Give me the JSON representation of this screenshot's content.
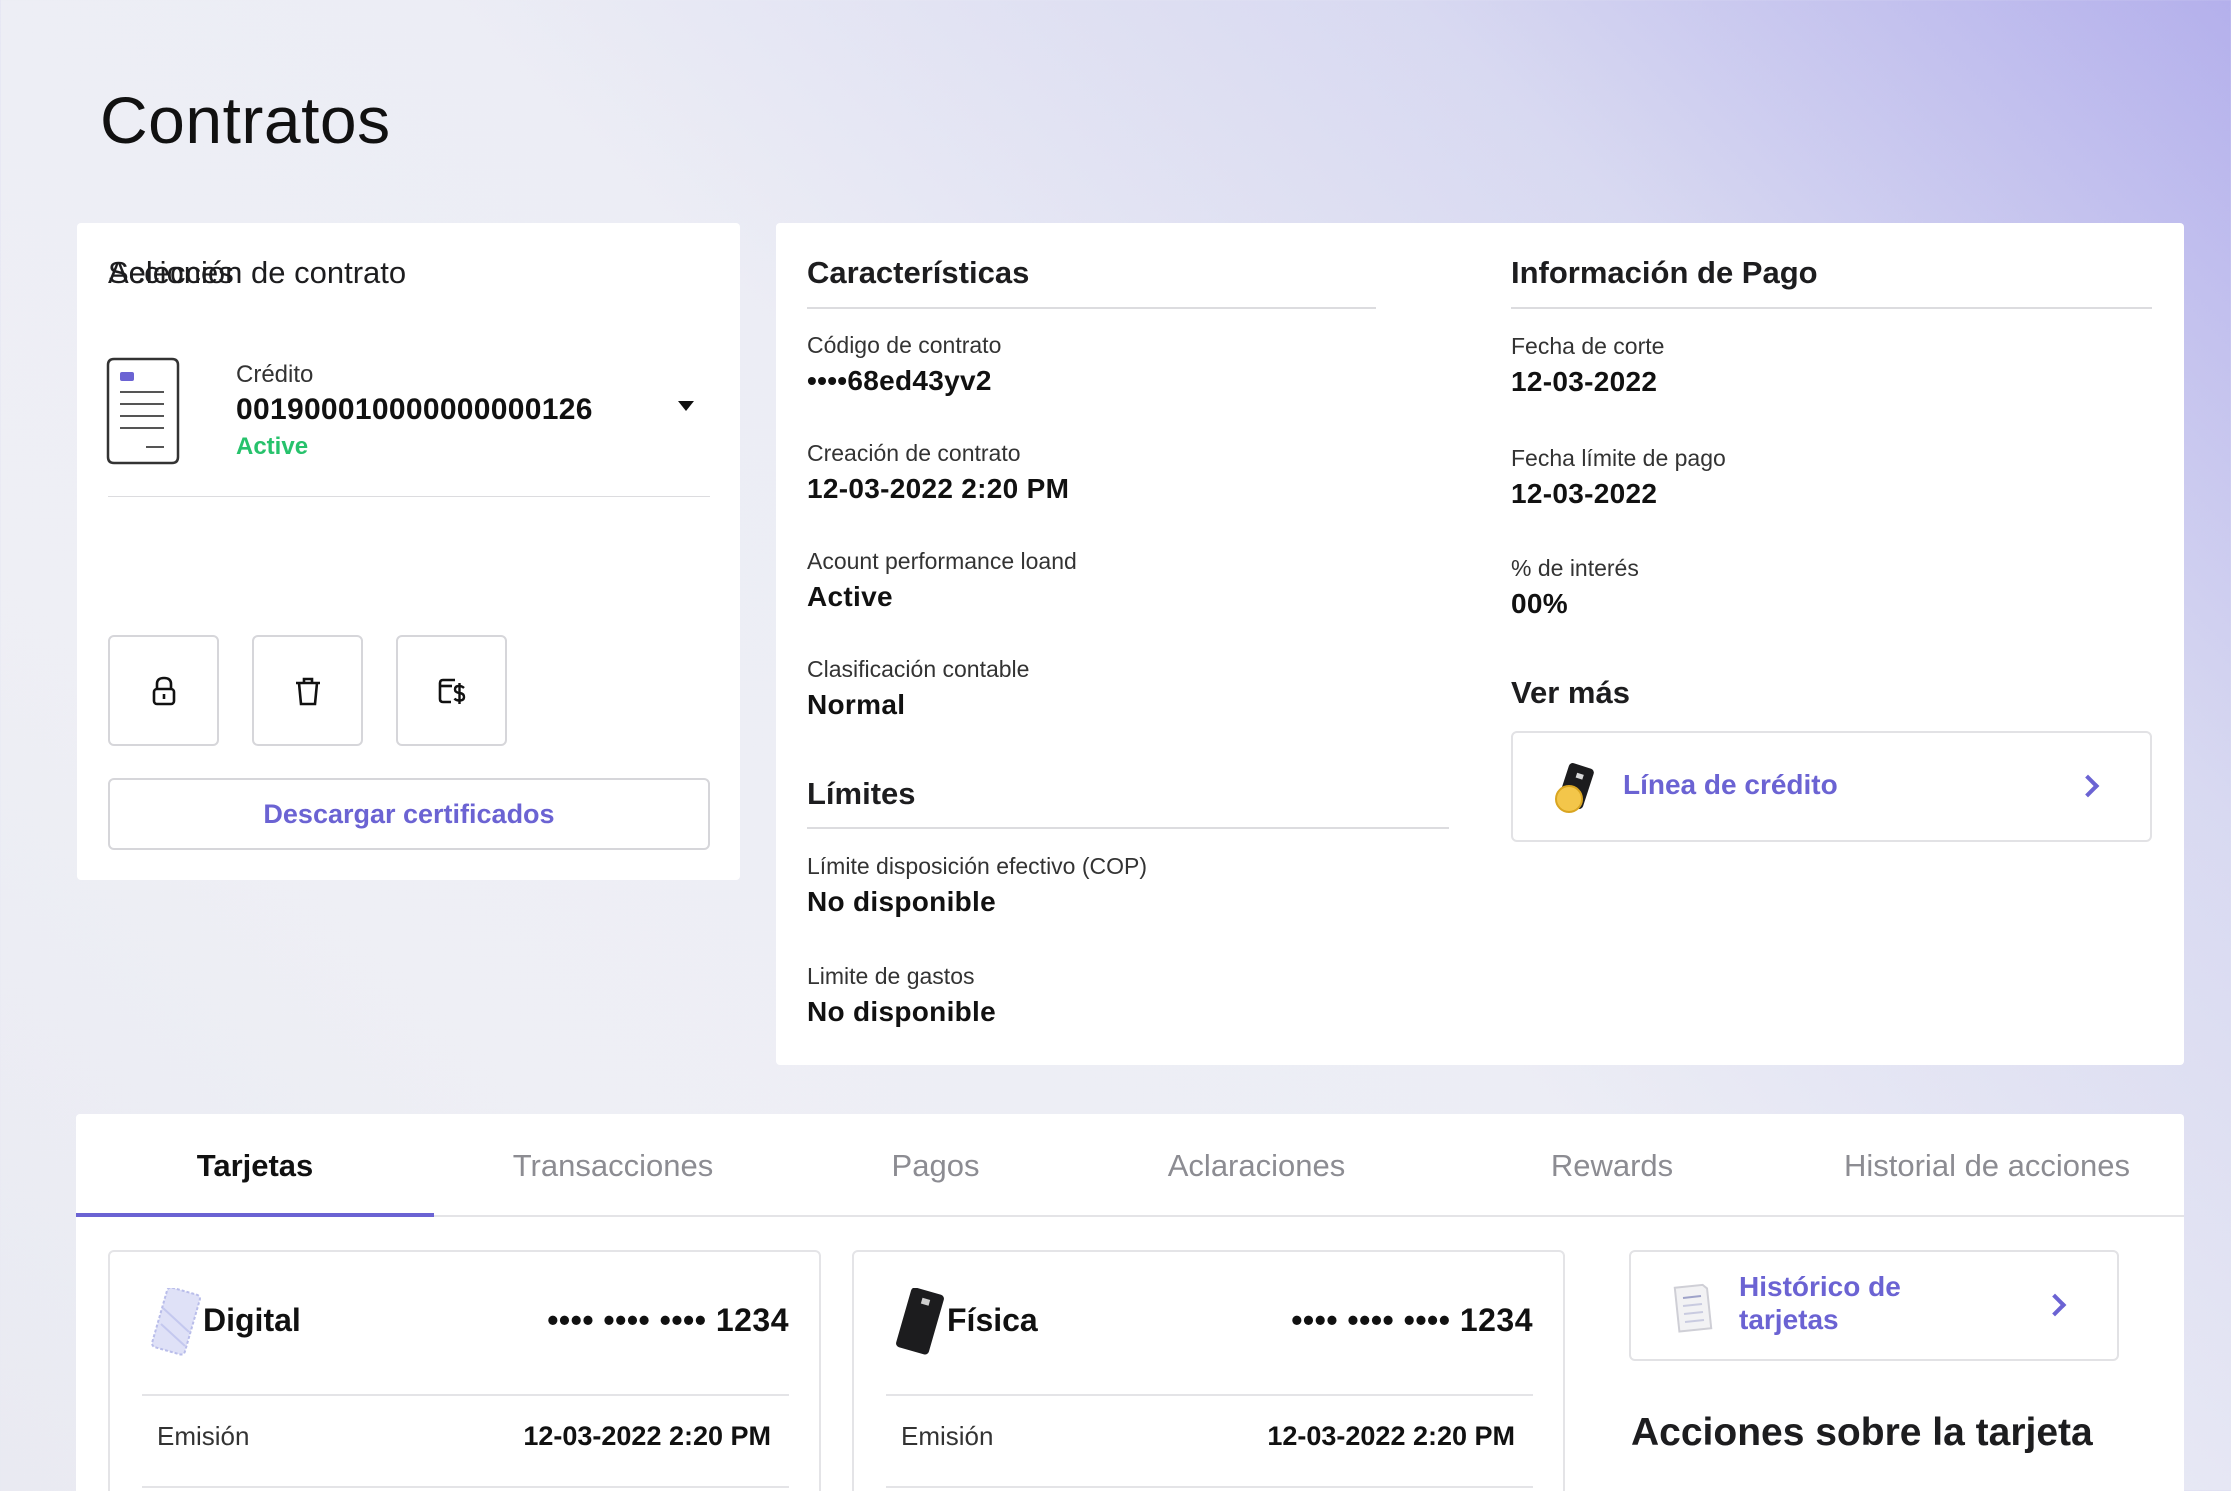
{
  "page": {
    "title": "Contratos"
  },
  "contract_selection": {
    "heading": "Selección de contrato",
    "contract": {
      "type": "Crédito",
      "number": "001900010000000000126",
      "status": "Active"
    },
    "actions_heading": "Acciones",
    "action_icons": [
      "lock-icon",
      "trash-icon",
      "money-card-icon"
    ],
    "download_label": "Descargar certificados"
  },
  "characteristics": {
    "heading": "Características",
    "fields": [
      {
        "label": "Código de contrato",
        "value": "••••68ed43yv2"
      },
      {
        "label": "Creación de contrato",
        "value": "12-03-2022 2:20 PM"
      },
      {
        "label": "Acount performance loand",
        "value": "Active"
      },
      {
        "label": "Clasificación contable",
        "value": "Normal"
      }
    ]
  },
  "limits": {
    "heading": "Límites",
    "fields": [
      {
        "label": "Límite disposición efectivo (COP)",
        "value": "No disponible"
      },
      {
        "label": "Limite de gastos",
        "value": "No disponible"
      }
    ]
  },
  "payment_info": {
    "heading": "Información de Pago",
    "fields": [
      {
        "label": "Fecha de corte",
        "value": "12-03-2022"
      },
      {
        "label": "Fecha límite de pago",
        "value": "12-03-2022"
      },
      {
        "label": "% de interés",
        "value": "00%"
      }
    ],
    "ver_mas_heading": "Ver más",
    "credit_line_label": "Línea de crédito"
  },
  "tabs": {
    "items": [
      "Tarjetas",
      "Transacciones",
      "Pagos",
      "Aclaraciones",
      "Rewards",
      "Historial de acciones"
    ],
    "active": "Tarjetas"
  },
  "cards": [
    {
      "title": "Digital",
      "number": "•••• •••• •••• 1234",
      "emission_label": "Emisión",
      "emission_date": "12-03-2022 2:20 PM"
    },
    {
      "title": "Física",
      "number": "•••• •••• •••• 1234",
      "emission_label": "Emisión",
      "emission_date": "12-03-2022 2:20 PM"
    }
  ],
  "card_history": {
    "label_line1": "Histórico de",
    "label_line2": "tarjetas"
  },
  "card_actions_heading": "Acciones sobre la tarjeta",
  "colors": {
    "accent": "#6b63d3",
    "status_active": "#27c26c",
    "text": "#111111"
  }
}
